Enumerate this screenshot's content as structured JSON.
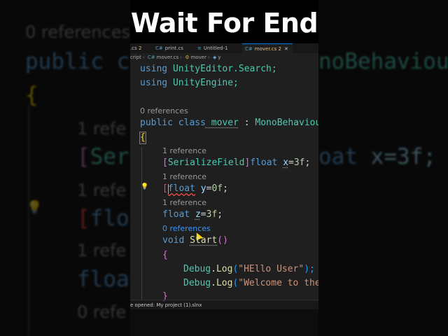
{
  "video_title": "Wait For End",
  "editor": {
    "tabs": [
      {
        "name": ".cs",
        "mod": "2"
      },
      {
        "name": "print.cs",
        "mod": ""
      },
      {
        "name": "Untitled-1",
        "mod": ""
      },
      {
        "name": "mover.cs",
        "mod": "2",
        "active": true
      }
    ],
    "close_glyph": "✕",
    "breadcrumb": [
      "cript",
      "mover.cs",
      "mover",
      "y"
    ],
    "lines": {
      "using_search": [
        "using",
        " UnityEditor.Search;"
      ],
      "using_engine": [
        "using",
        " UnityEngine;"
      ],
      "lens_class": "0 references",
      "class_decl": [
        "public",
        " class",
        " mover",
        " : ",
        "MonoBehaviou"
      ],
      "brace_open": "{",
      "lens_x": "1 reference",
      "field_x": [
        "[",
        "SerializeField",
        "]",
        "float",
        " ",
        "x",
        "=",
        "3f",
        ";"
      ],
      "lens_y": "1 reference",
      "field_y": [
        "[",
        "float",
        " ",
        "y",
        "=",
        "0f",
        ";"
      ],
      "lens_z": "1 reference",
      "field_z": [
        "float",
        " ",
        "z",
        "=",
        "3f",
        ";"
      ],
      "lens_start": "0 references",
      "start_decl": [
        "void",
        " ",
        "Start",
        "()"
      ],
      "brace_start": "{",
      "log1": [
        "Debug",
        ".",
        "Log",
        "(",
        "\"HEllo User\"",
        ");"
      ],
      "log2": [
        "Debug",
        ".",
        "Log",
        "(",
        "\"Welcome to the"
      ],
      "brace_close": "}"
    },
    "status_text": "e opened: My project (1).slnx"
  },
  "background": {
    "ref0": "0 references",
    "class_left": [
      "public",
      " c"
    ],
    "class_right": "noBehaviou",
    "brace": "{",
    "ref1": "1 refe",
    "ser_left": [
      "[",
      "Ser"
    ],
    "ser_right": [
      "oat",
      " x=3f;"
    ],
    "ref2": "1 refe",
    "float_left": [
      "[",
      "flo"
    ],
    "ref3": "1 refe",
    "float_left2": "float",
    "ref4": "0 refe"
  },
  "colors": {
    "keyword": "#569cd6",
    "type": "#4ec9b0",
    "identifier": "#9cdcfe",
    "function": "#dcdcaa",
    "string": "#ce9178",
    "editor_bg": "#1f1f1f"
  }
}
